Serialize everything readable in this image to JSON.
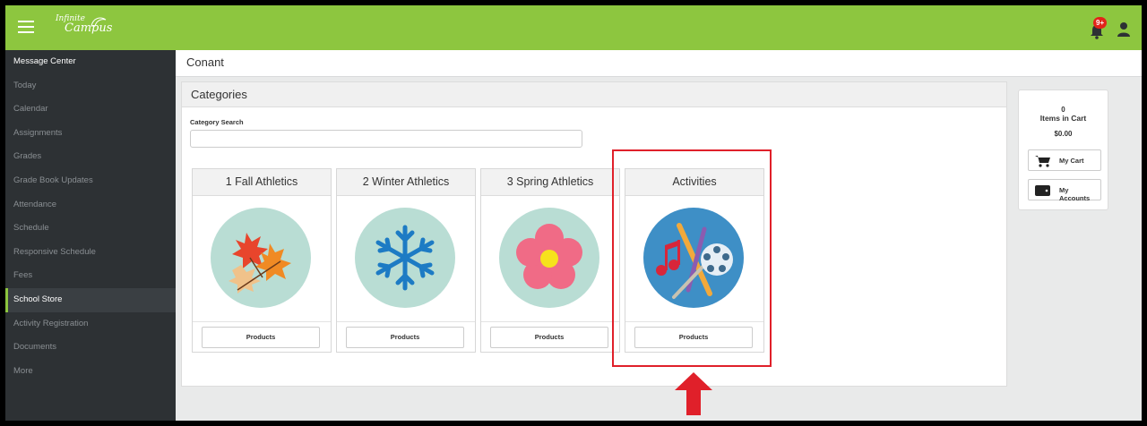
{
  "app": {
    "logo_line1": "Infinite",
    "logo_line2": "Campus",
    "notification_badge": "9+"
  },
  "sidebar": {
    "items": [
      {
        "label": "Message Center"
      },
      {
        "label": "Today"
      },
      {
        "label": "Calendar"
      },
      {
        "label": "Assignments"
      },
      {
        "label": "Grades"
      },
      {
        "label": "Grade Book Updates"
      },
      {
        "label": "Attendance"
      },
      {
        "label": "Schedule"
      },
      {
        "label": "Responsive Schedule"
      },
      {
        "label": "Fees"
      },
      {
        "label": "School Store"
      },
      {
        "label": "Activity Registration"
      },
      {
        "label": "Documents"
      },
      {
        "label": "More"
      }
    ],
    "active_index": 10
  },
  "breadcrumb": {
    "school": "Conant"
  },
  "categories": {
    "title": "Categories",
    "search_label": "Category Search",
    "search_value": "",
    "cards": [
      {
        "title": "1 Fall Athletics",
        "icon": "fall-leaves-icon",
        "button": "Products"
      },
      {
        "title": "2 Winter Athletics",
        "icon": "snowflake-icon",
        "button": "Products"
      },
      {
        "title": "3 Spring Athletics",
        "icon": "flower-icon",
        "button": "Products"
      },
      {
        "title": "Activities",
        "icon": "arts-activities-icon",
        "button": "Products"
      }
    ]
  },
  "cart": {
    "count": "0",
    "items_label": "Items in Cart",
    "total": "$0.00",
    "my_cart_label": "My Cart",
    "my_accounts_label": "My Accounts"
  },
  "colors": {
    "brand_green": "#8dc63f",
    "sidebar_bg": "#2d3134",
    "highlight_red": "#e0202a"
  }
}
